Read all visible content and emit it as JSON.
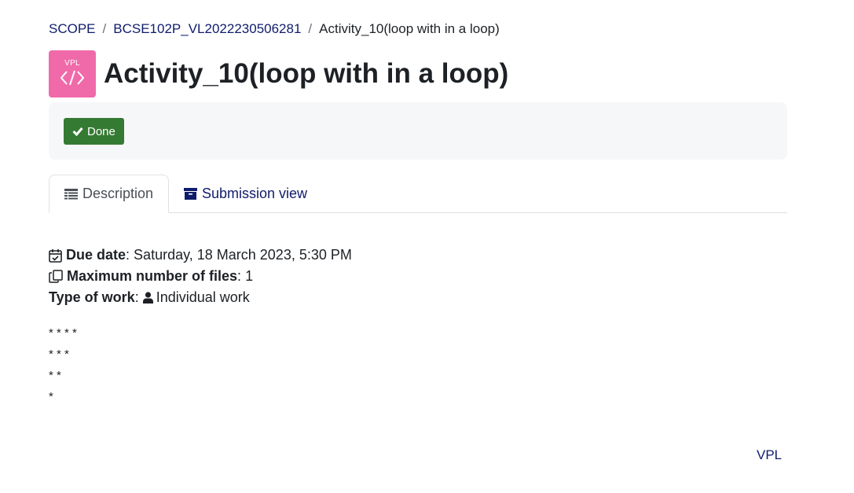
{
  "breadcrumb": {
    "items": [
      "SCOPE",
      "BCSE102P_VL2022230506281",
      "Activity_10(loop with in a loop)"
    ],
    "separator": "/"
  },
  "module_icon": {
    "label": "VPL",
    "icon": "code-brackets-icon",
    "color": "#f06aa9"
  },
  "page": {
    "title": "Activity_10(loop with in a loop)"
  },
  "completion": {
    "done_label": "Done",
    "icon": "check-icon",
    "color": "#357a32"
  },
  "tabs": [
    {
      "label": "Description",
      "icon": "list-icon",
      "active": true
    },
    {
      "label": "Submission view",
      "icon": "archive-icon",
      "active": false
    }
  ],
  "details": {
    "due_date_label": "Due date",
    "due_date_value": "Saturday, 18 March 2023, 5:30 PM",
    "max_files_label": "Maximum number of files",
    "max_files_value": "1",
    "work_type_label": "Type of work",
    "work_type_value": "Individual work"
  },
  "pattern_lines": [
    "* * * *",
    "* * *",
    "* *",
    "*"
  ],
  "footer": {
    "link_label": "VPL"
  }
}
